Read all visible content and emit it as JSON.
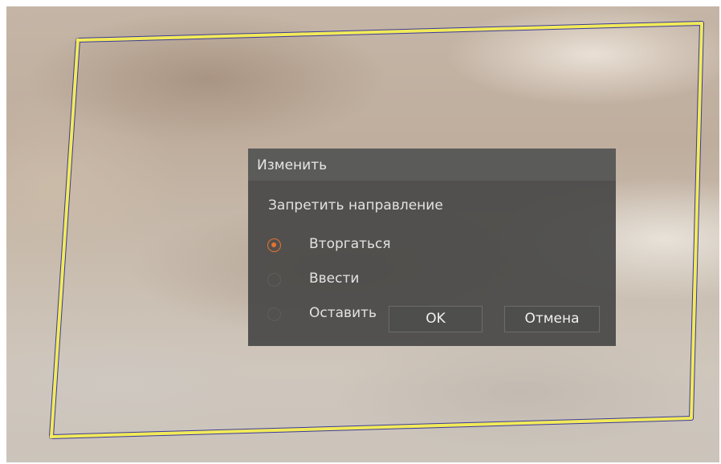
{
  "dialog": {
    "title": "Изменить",
    "section_label": "Запретить направление",
    "options": [
      {
        "label": "Вторгаться",
        "checked": true
      },
      {
        "label": "Ввести",
        "checked": false
      },
      {
        "label": "Оставить",
        "checked": false
      }
    ],
    "ok_label": "OK",
    "cancel_label": "Отмена"
  },
  "colors": {
    "region_outline": "#f2ea5a",
    "radio_accent": "#e8722c",
    "dialog_background": "#484846",
    "dialog_header": "#5c5c5a"
  }
}
